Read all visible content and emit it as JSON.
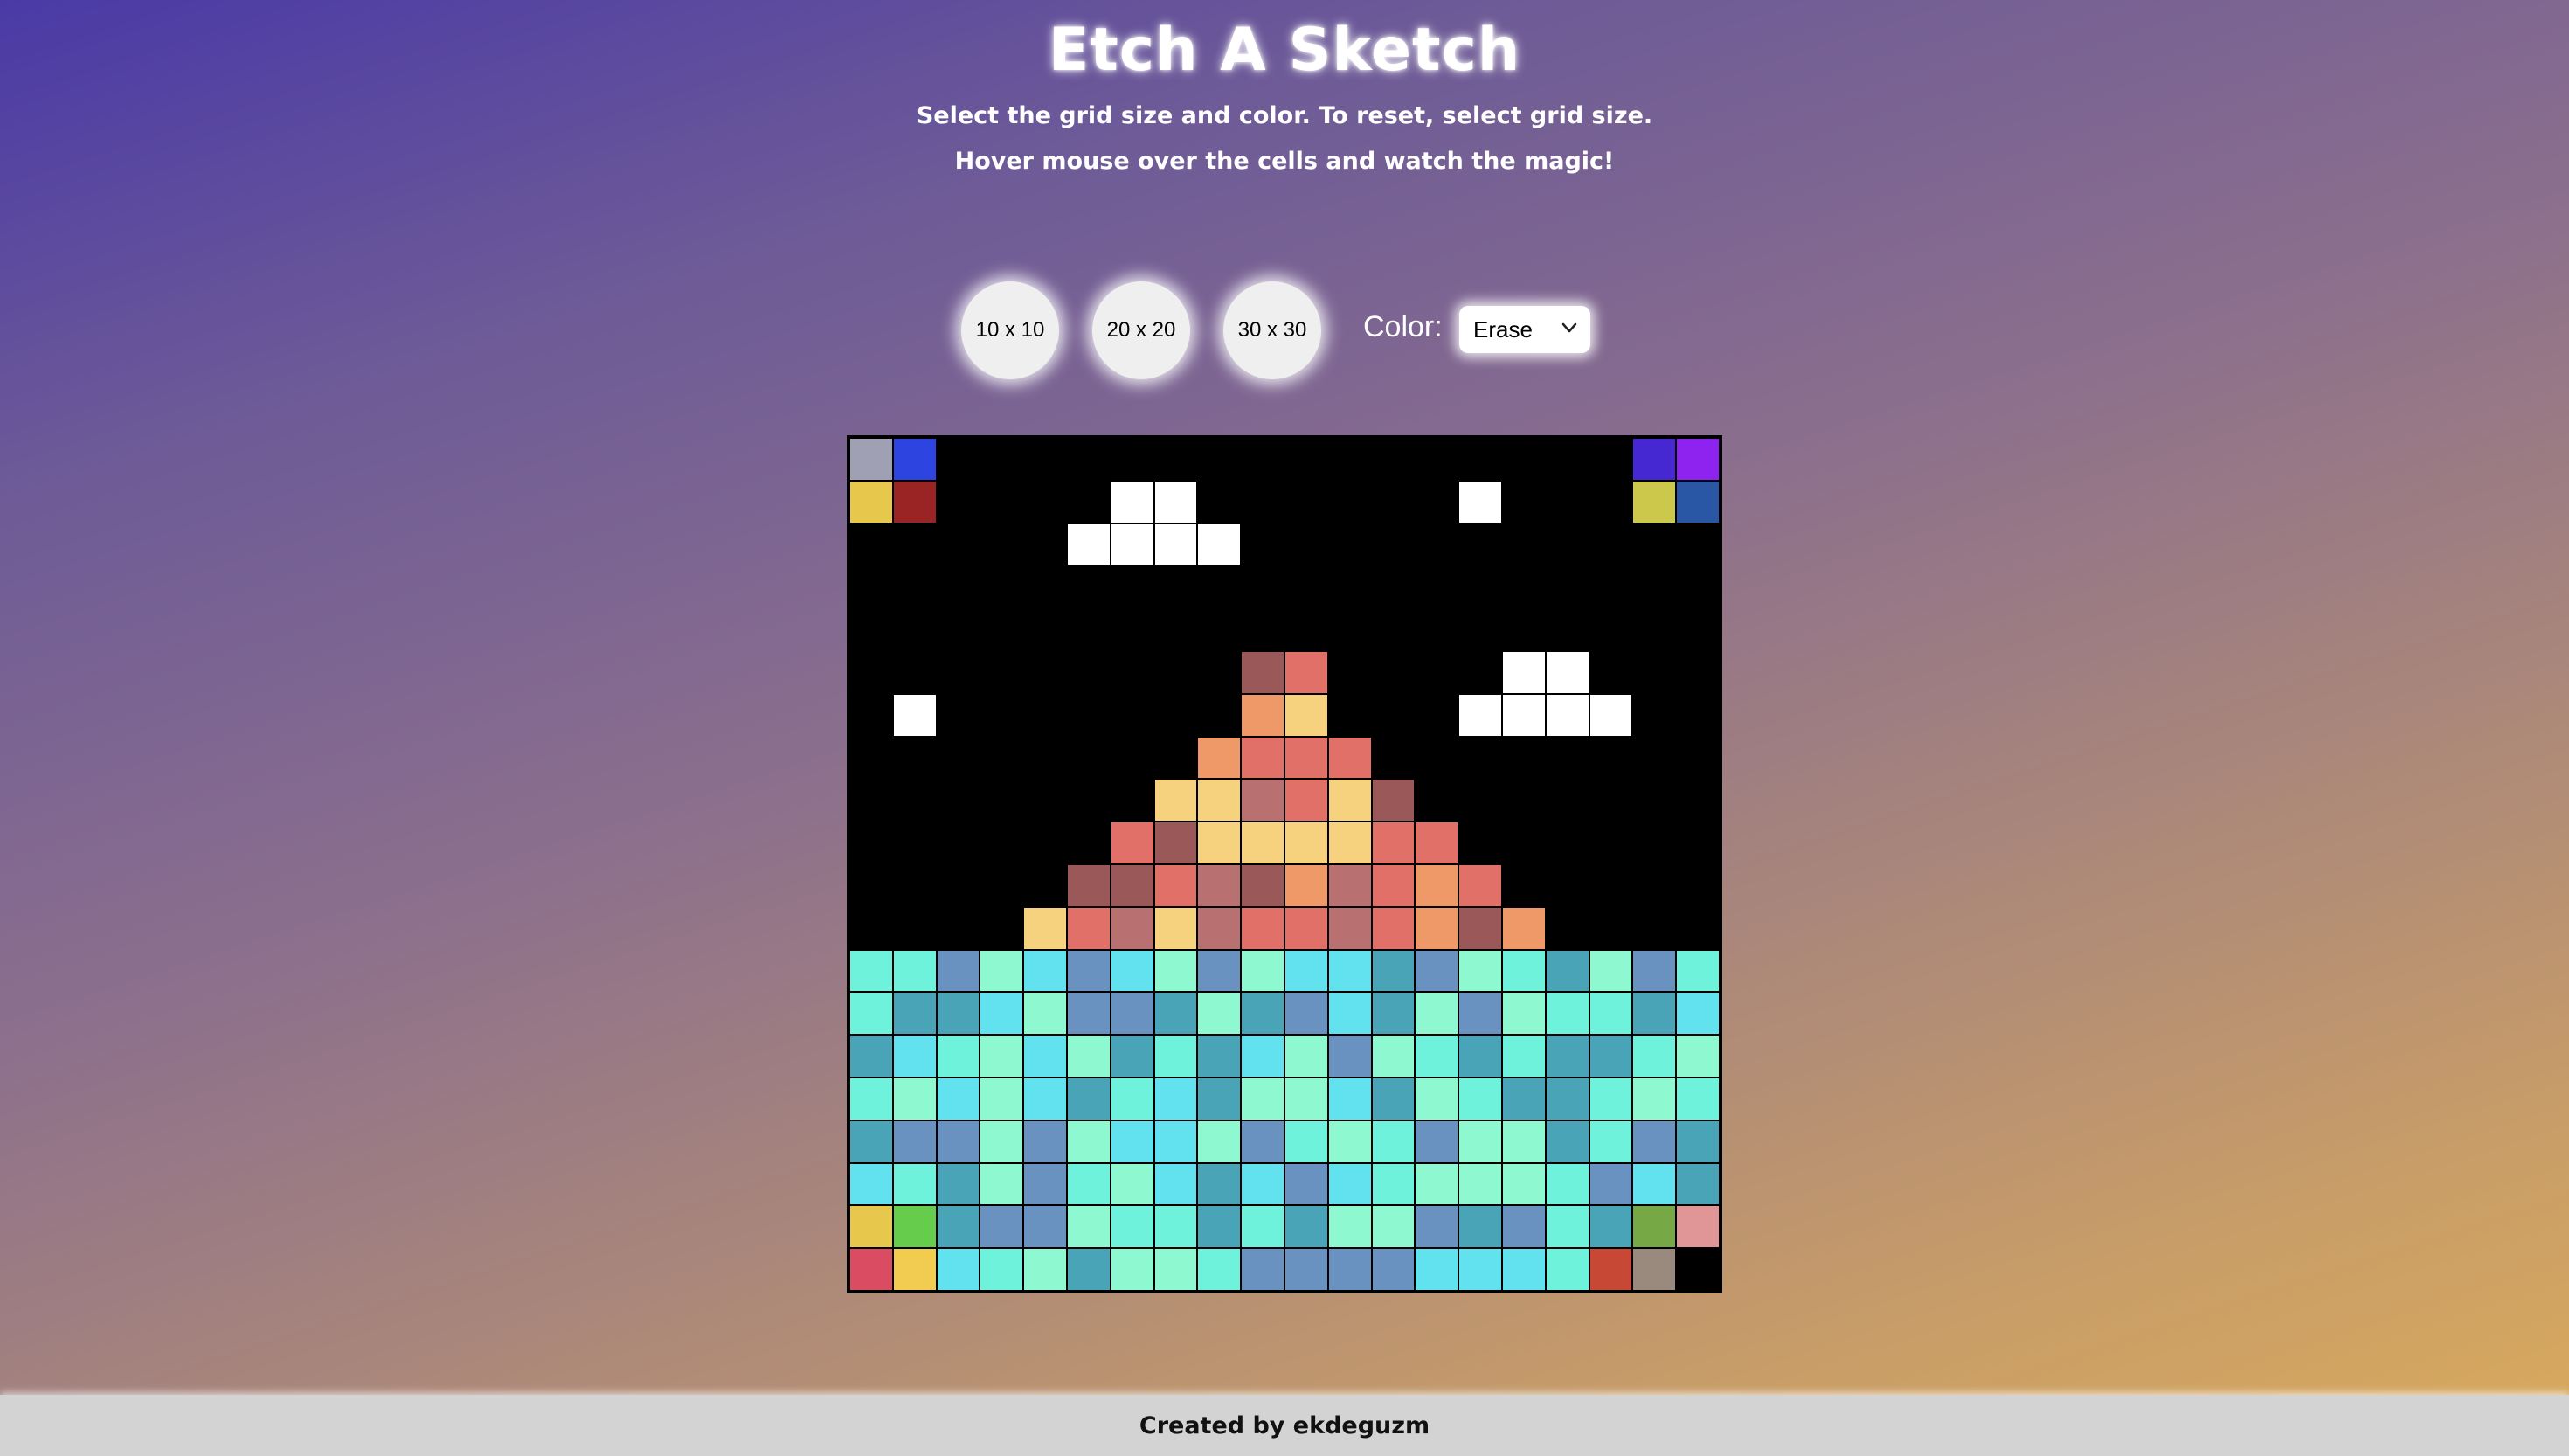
{
  "header": {
    "title": "Etch A Sketch",
    "instructions_line1": "Select the grid size and color. To reset, select grid size.",
    "instructions_line2": "Hover mouse over the cells and watch the magic!"
  },
  "controls": {
    "size_buttons": [
      "10 x 10",
      "20 x 20",
      "30 x 30"
    ],
    "color_label": "Color:",
    "color_selected": "Erase"
  },
  "grid": {
    "size": 20,
    "palette": {
      "k": "#000000",
      "W": "#ffffff",
      "a": "#e07068",
      "b": "#9b5858",
      "c": "#ef9868",
      "d": "#f6d27e",
      "e": "#b87070",
      "f": "#e4776b",
      "C": "#6ef2dc",
      "M": "#8ef8d0",
      "S": "#6a92c0",
      "T": "#48a4b6",
      "L": "#62e2ee",
      "g": "#a0a0b4",
      "h": "#2e44e0",
      "i": "#e8c84c",
      "j": "#9a2424",
      "n": "#4628d2",
      "o": "#8e22ee",
      "p": "#ccc84c",
      "q": "#2a56a6",
      "r": "#e8cc50",
      "s": "#66cc4c",
      "t": "#76a846",
      "u": "#e09696",
      "v": "#da4c62",
      "w": "#f2cc50",
      "x": "#c84836",
      "y": "#9a8a7e"
    },
    "rows": [
      "ghkkkkkkkkkkkkkkkkno",
      "ijkkkkWWkkkkkkWkkkpq",
      "kkkkkWWWWkkkkkkkkkkk",
      "kkkkkkkkkkkkkkkkkkkk",
      "kkkkkkkkkkkkkkkkkkkk",
      "kkkkkkkkkbakkkkWWkkk",
      "kWkkkkkkkcdkkkWWWWkk",
      "kkkkkkkkcaaakkkkkkkk",
      "kkkkkkkddeadbkkkkkkk",
      "kkkkkkabddddaakkkkkk",
      "kkkkkbbaebceacakkkkk",
      "kkkkdaedeaaeacbckkkk",
      "CCSMLSLMSMLLTSMCTMSC",
      "CTTLMSSTMTSLTMSMCCTL",
      "TLCMLMTCTLMSMCTCTTCM",
      "CMLMLTCLTMMLTMCTTCMC",
      "TSSMSMLLMSCMCSMMTCST",
      "LCTMSCMLTLSLCMMMCSLT",
      "isTSSMCCTCTMMSTSCTtu",
      "vwLCMTMMCSSSSLLLCxyk"
    ]
  },
  "footer": {
    "text": "Created by ekdeguzm"
  }
}
